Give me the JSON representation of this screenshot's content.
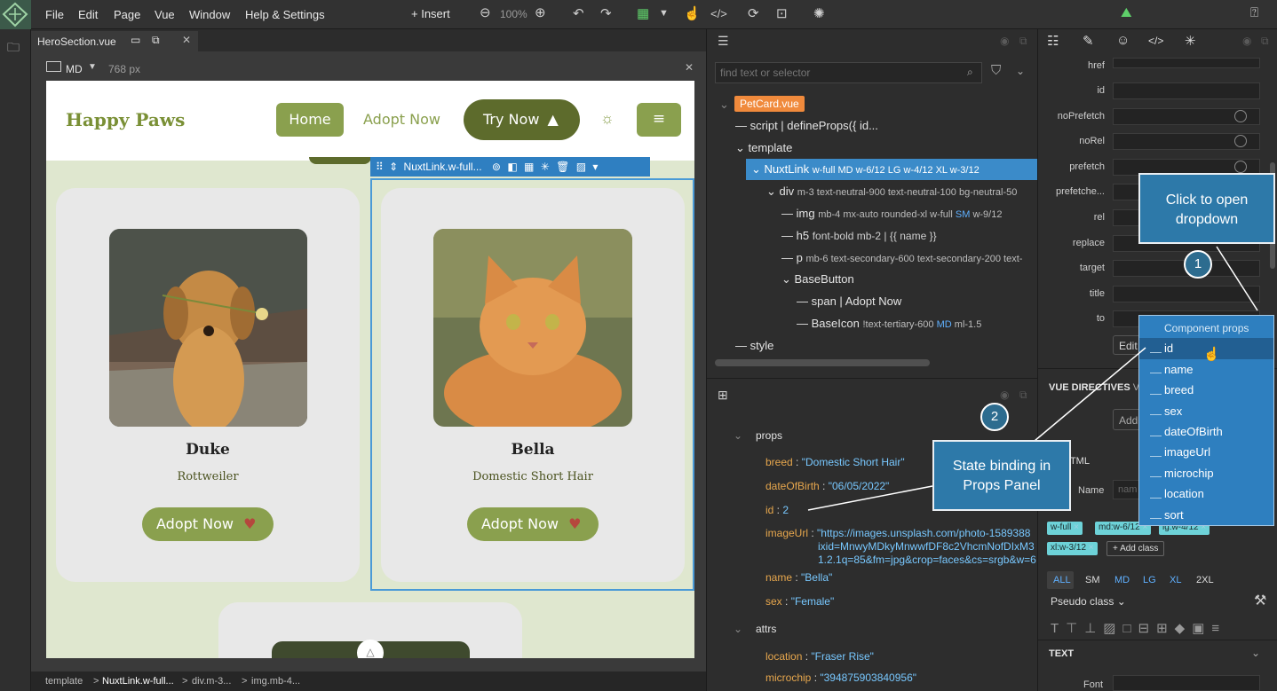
{
  "menu": [
    "File",
    "Edit",
    "Page",
    "Vue",
    "Window",
    "Help & Settings"
  ],
  "toolbar": {
    "insert": "Insert",
    "zoom": "100%"
  },
  "doc_tab": {
    "title": "HeroSection.vue"
  },
  "viewport": {
    "size": "MD",
    "width": "768 px"
  },
  "site": {
    "brand": "Happy Paws",
    "nav": {
      "home": "Home",
      "adopt": "Adopt Now",
      "try": "Try Now"
    },
    "selection_label": "NuxtLink.w-full...",
    "cards": [
      {
        "name": "Duke",
        "breed": "Rottweiler",
        "button": "Adopt Now"
      },
      {
        "name": "Bella",
        "breed": "Domestic Short Hair",
        "button": "Adopt Now"
      }
    ]
  },
  "search": {
    "placeholder": "find text or selector"
  },
  "tree": {
    "root": "PetCard.vue",
    "script": "script | defineProps({ id...",
    "template": "template",
    "nuxtlink": "NuxtLink",
    "nuxtlink_classes": "w-full",
    "nuxtlink_md": "MD",
    "nuxtlink_md_cls": "w-6/12",
    "nuxtlink_lg": "LG",
    "nuxtlink_lg_cls": "w-4/12",
    "nuxtlink_xl": "XL",
    "nuxtlink_xl_cls": "w-3/12",
    "div": "div",
    "div_classes": "m-3 text-neutral-900 text-neutral-100 bg-neutral-50",
    "img": "img",
    "img_classes": "mb-4 mx-auto rounded-xl w-full",
    "img_sm": "SM",
    "img_sm_cls": "w-9/12",
    "h5": "h5",
    "h5_classes": "font-bold mb-2 | {{ name }}",
    "p": "p",
    "p_classes": "mb-6 text-secondary-600 text-secondary-200 text-",
    "basebutton": "BaseButton",
    "span": "span | Adopt Now",
    "baseicon": "BaseIcon",
    "baseicon_classes": "!text-tertiary-600",
    "baseicon_md": "MD",
    "baseicon_md_cls": "ml-1.5",
    "style": "style"
  },
  "props_panel": {
    "props_header": "props",
    "items": [
      {
        "k": "breed",
        "v": "\"Domestic Short Hair\""
      },
      {
        "k": "dateOfBirth",
        "v": "\"06/05/2022\""
      },
      {
        "k": "id",
        "v": "2"
      },
      {
        "k": "imageUrl",
        "v": "\"https://images.unsplash.com/photo-1589388"
      },
      {
        "k": "name",
        "v": "\"Bella\""
      },
      {
        "k": "sex",
        "v": "\"Female\""
      }
    ],
    "image_url_l2": "ixid=MnwyMDkyMnwwfDF8c2VhcmNofDIxM3",
    "image_url_l3": "1.2.1q=85&fm=jpg&crop=faces&cs=srgb&w=6",
    "attrs_header": "attrs",
    "attrs": [
      {
        "k": "location",
        "v": "\"Fraser Rise\""
      },
      {
        "k": "microchip",
        "v": "\"394875903840956\""
      }
    ]
  },
  "properties": {
    "labels": [
      "href",
      "id",
      "noPrefetch",
      "noRel",
      "prefetch",
      "prefetche...",
      "rel",
      "replace",
      "target",
      "title",
      "to"
    ],
    "edit": "Edit",
    "vue_directives": "VUE DIRECTIVES",
    "vue_suffix": "Vu",
    "add": "Add",
    "html": "HTML",
    "name_label": "Name",
    "name_placeholder": "nam",
    "classes": [
      "w-full",
      "md:w-6/12",
      "lg:w-4/12",
      "xl:w-3/12"
    ],
    "add_class": "+ Add class",
    "breakpoints": [
      "ALL",
      "SM",
      "MD",
      "LG",
      "XL",
      "2XL"
    ],
    "pseudo": "Pseudo class",
    "text_header": "TEXT",
    "font_label": "Font"
  },
  "dropdown": {
    "header": "Component props",
    "items": [
      "id",
      "name",
      "breed",
      "sex",
      "dateOfBirth",
      "imageUrl",
      "microchip",
      "location",
      "sort"
    ]
  },
  "callouts": {
    "one_text": "Click to open dropdown",
    "one_num": "1",
    "two_text": "State binding in Props Panel",
    "two_num": "2"
  },
  "breadcrumb": [
    "template",
    "NuxtLink.w-full...",
    "div.m-3...",
    "img.mb-4..."
  ],
  "colors": {
    "accent": "#7a9036",
    "dropdown": "#2e7fbf",
    "callout": "#2d79a9",
    "selection": "#2f7fc1"
  }
}
